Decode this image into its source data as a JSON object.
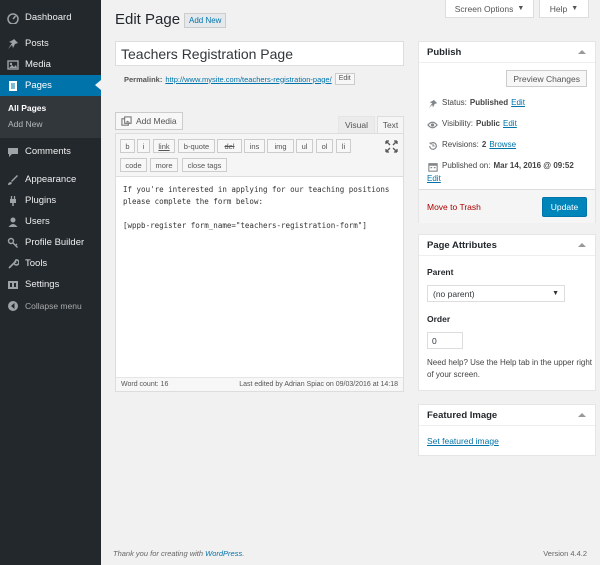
{
  "sidebar": {
    "items": [
      {
        "label": "Dashboard",
        "icon": "dashboard-icon"
      },
      {
        "label": "Posts",
        "icon": "pin-icon"
      },
      {
        "label": "Media",
        "icon": "media-icon"
      },
      {
        "label": "Pages",
        "icon": "page-icon"
      },
      {
        "label": "Comments",
        "icon": "comment-icon"
      },
      {
        "label": "Appearance",
        "icon": "brush-icon"
      },
      {
        "label": "Plugins",
        "icon": "plug-icon"
      },
      {
        "label": "Users",
        "icon": "user-icon"
      },
      {
        "label": "Profile Builder",
        "icon": "key-icon"
      },
      {
        "label": "Tools",
        "icon": "wrench-icon"
      },
      {
        "label": "Settings",
        "icon": "settings-icon"
      }
    ],
    "submenu": [
      "All Pages",
      "Add New"
    ],
    "collapse": "Collapse menu"
  },
  "header": {
    "screen_options": "Screen Options",
    "help": "Help",
    "title": "Edit Page",
    "add_new": "Add New"
  },
  "post": {
    "title": "Teachers Registration Page",
    "permalink_label": "Permalink:",
    "permalink_url": "http://www.mysite.com/teachers-registration-page/",
    "permalink_edit": "Edit"
  },
  "editor": {
    "add_media": "Add Media",
    "tab_visual": "Visual",
    "tab_text": "Text",
    "quicktags": [
      "b",
      "i",
      "link",
      "b-quote",
      "del",
      "ins",
      "img",
      "ul",
      "ol",
      "li",
      "code",
      "more",
      "close tags"
    ],
    "content": "If you're interested in applying for our teaching positions\nplease complete the form below:\n\n[wppb-register form_name=\"teachers-registration-form\"]",
    "word_count": "Word count: 16",
    "last_edited": "Last edited by Adrian Spiac on 09/03/2016 at 14:18"
  },
  "publish": {
    "title": "Publish",
    "preview": "Preview Changes",
    "status_label": "Status:",
    "status_value": "Published",
    "visibility_label": "Visibility:",
    "visibility_value": "Public",
    "revisions_label": "Revisions:",
    "revisions_value": "2",
    "browse": "Browse",
    "published_label": "Published on:",
    "published_value": "Mar 14, 2016 @ 09:52",
    "edit": "Edit",
    "trash": "Move to Trash",
    "update": "Update"
  },
  "page_attributes": {
    "title": "Page Attributes",
    "parent_label": "Parent",
    "parent_value": "(no parent)",
    "order_label": "Order",
    "order_value": "0",
    "help": "Need help? Use the Help tab in the upper right of your screen."
  },
  "featured_image": {
    "title": "Featured Image",
    "set_link": "Set featured image"
  },
  "footer": {
    "thanks_prefix": "Thank you for creating with ",
    "thanks_link": "WordPress",
    "thanks_suffix": ".",
    "version": "Version 4.4.2"
  },
  "colors": {
    "sidebar_bg": "#23282d",
    "accent": "#0073aa",
    "primary_button": "#0085ba",
    "trash": "#a00"
  }
}
